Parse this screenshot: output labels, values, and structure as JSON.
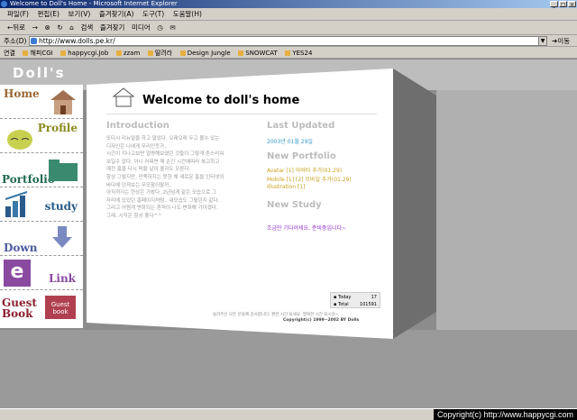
{
  "window": {
    "title": "Welcome to Doll's Home - Microsoft Internet Explorer"
  },
  "menu": [
    "파일(F)",
    "편집(E)",
    "보기(V)",
    "즐겨찾기(A)",
    "도구(T)",
    "도움말(H)"
  ],
  "toolbar": {
    "back": "←뒤로",
    "forward": "→",
    "search": "검색",
    "favorites": "즐겨찾기",
    "media": "미디어"
  },
  "address": {
    "label": "주소(D)",
    "url": "http://www.dolls.pe.kr/",
    "go": "이동"
  },
  "links": {
    "label": "연결",
    "items": [
      "해피CGI",
      "happycgi.Job",
      "zzam",
      "딸려라",
      "Design Jungle",
      "SNOWCAT",
      "YES24"
    ]
  },
  "site": {
    "title": "Doll's",
    "nav": [
      {
        "label": "Home"
      },
      {
        "label": "Profile"
      },
      {
        "label": "Portfolio"
      },
      {
        "label": "study"
      },
      {
        "label": "Down"
      },
      {
        "label": "Link"
      },
      {
        "label": "Guest Book"
      }
    ],
    "link_icon_letter": "e",
    "guestbook_icon": "Guest book"
  },
  "main": {
    "welcome": "Welcome to doll's home",
    "intro": {
      "heading": "Introduction",
      "lines": [
        "또다시 리뉴얼을 하고 말았다. 오래오래 두고 볼수 있는",
        "디자인은 나에게 무리인듯가..",
        "시간이 지나고보면 멀쩡해보였던 것들이 그렇게 촌스러워",
        "보일수 없다. 아니 어쩌면 매 순간 시간에따라 복고하고",
        "예전 홈을 다시 띄울 날이 올지도 모른다.",
        "항상 그렇지만, 만족하지는 못한 채 새로운 홈을 인터넷의",
        "바다에 던져보는 무모함이랄까..",
        "아직까지는 현상은 가봤다. 2년넘게 같은 모습으로 그",
        "자리에 있었던 홈페이지처럼.. 내모습도 그렇던지 같다.",
        "그리고 어렴게 변화되는 흔적이 나도 변화해 가야겠다.",
        "그래..시작은 항상 좋다^^"
      ]
    },
    "updated": {
      "heading": "Last Updated",
      "date": "2003년 01월 29일"
    },
    "portfolio": {
      "heading": "New Portfolio",
      "items": [
        "Avatar [1]  아바타 추가(01.29)",
        "Mobile [1] [2]  모바일 추가(01.29)",
        "Illustration [1]"
      ]
    },
    "study": {
      "heading": "New Study",
      "text": "조금만 기다려세요. 준비중입니다~"
    },
    "counter": {
      "today_label": "Today",
      "today": "17",
      "total_label": "Total",
      "total": "101591"
    },
    "footer1": "들러주신 모든 분들께 감사합니다. 편한 시간 되세요. 행복한 시간 되시길~",
    "footer2": "Copyright(c) 1999~2002 BY Dolls"
  },
  "status": {
    "copyright": "Copyright(c) http://www.happycgi.com"
  }
}
